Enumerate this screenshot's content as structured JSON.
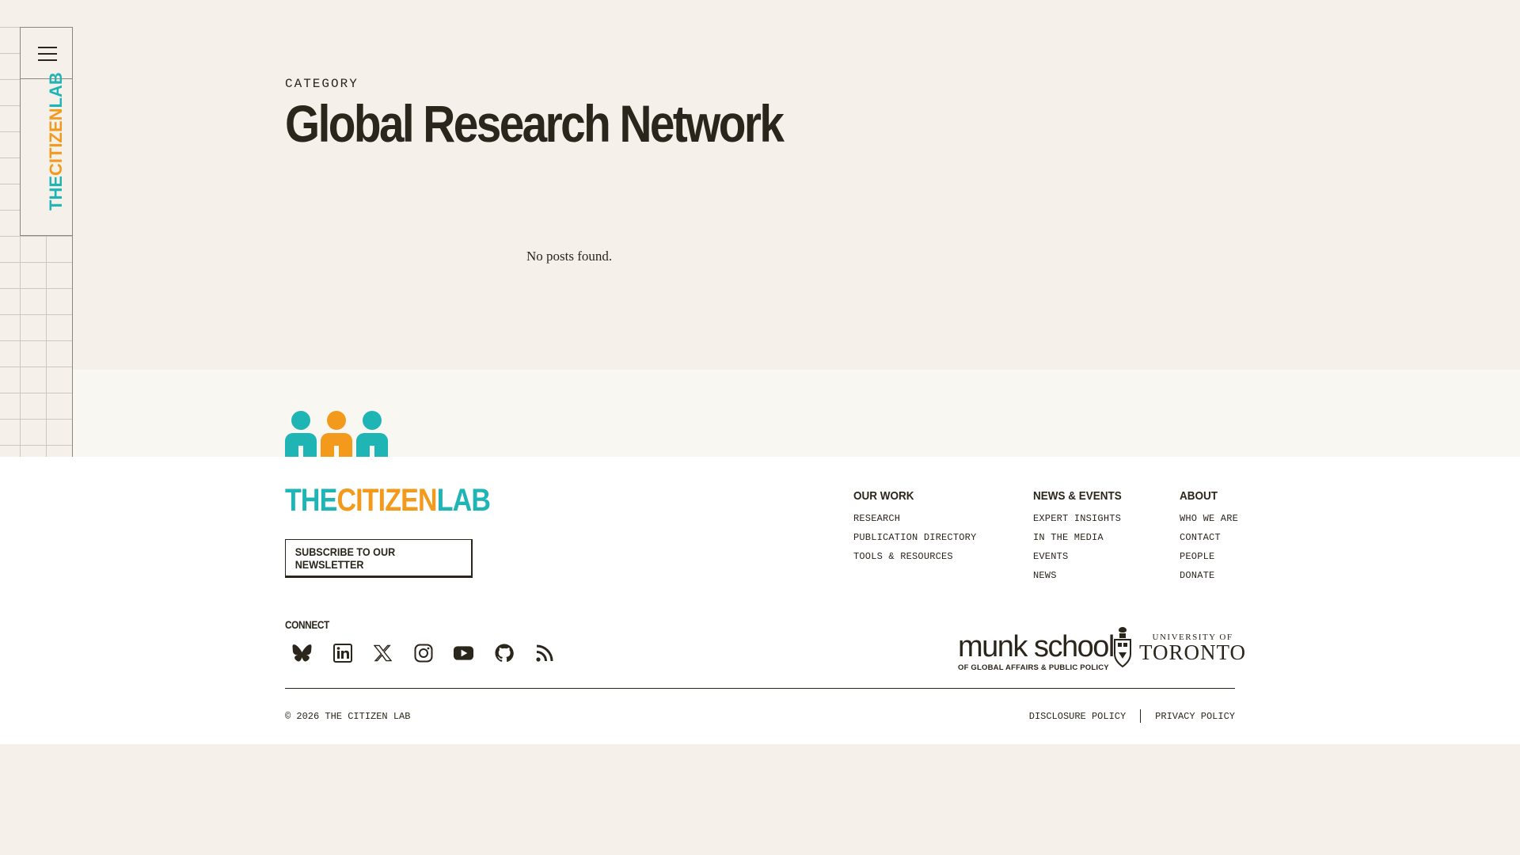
{
  "sidebar": {
    "logo": {
      "the": "THE",
      "citizen": "CITIZEN",
      "lab": "LAB"
    },
    "menu_icon": "hamburger-icon",
    "search_icon": "search-icon"
  },
  "header": {
    "category_label": "CATEGORY",
    "title": "Global Research Network"
  },
  "main": {
    "empty_message": "No posts found."
  },
  "footer": {
    "logo": {
      "the": "THE",
      "citizen": "CITIZEN",
      "lab": "LAB"
    },
    "subscribe_label": "SUBSCRIBE TO OUR NEWSLETTER",
    "columns": [
      {
        "heading": "OUR WORK",
        "links": [
          "RESEARCH",
          "PUBLICATION DIRECTORY",
          "TOOLS & RESOURCES"
        ]
      },
      {
        "heading": "NEWS & EVENTS",
        "links": [
          "EXPERT INSIGHTS",
          "IN THE MEDIA",
          "EVENTS",
          "NEWS"
        ]
      },
      {
        "heading": "ABOUT",
        "links": [
          "WHO WE ARE",
          "CONTACT",
          "PEOPLE",
          "DONATE"
        ]
      }
    ],
    "connect_label": "CONNECT",
    "social_icons": [
      "bluesky-icon",
      "linkedin-icon",
      "x-icon",
      "instagram-icon",
      "youtube-icon",
      "github-icon",
      "rss-icon"
    ],
    "partners": {
      "munk_big": "munk school",
      "munk_small": "OF GLOBAL AFFAIRS & PUBLIC POLICY",
      "uoft_top": "UNIVERSITY OF",
      "uoft_bottom": "TORONTO"
    },
    "copyright": "© 2026 THE CITIZEN LAB",
    "legal": {
      "disclosure": "DISCLOSURE POLICY",
      "privacy": "PRIVACY POLICY"
    }
  },
  "colors": {
    "background": "#f5f1ea",
    "text": "#2b261c",
    "teal": "#1fb5b5",
    "orange": "#f39a1c",
    "footer_bg": "#ffffff"
  }
}
